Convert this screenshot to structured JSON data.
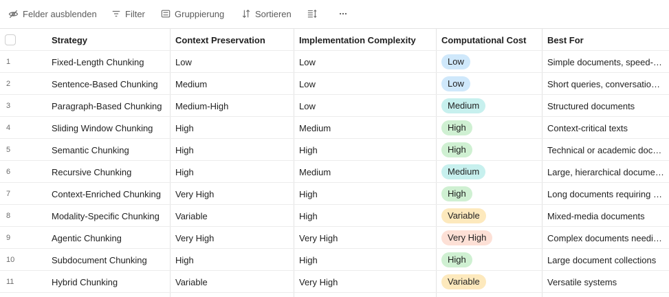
{
  "toolbar": {
    "hide_fields": "Felder ausblenden",
    "filter": "Filter",
    "group": "Gruppierung",
    "sort": "Sortieren",
    "icons": [
      "eye-slash-icon",
      "filter-icon",
      "group-icon",
      "sort-icon",
      "row-height-icon",
      "more-icon"
    ]
  },
  "table": {
    "columns": [
      "Strategy",
      "Context Preservation",
      "Implementation Complexity",
      "Computational Cost",
      "Best For"
    ],
    "rows": [
      {
        "num": "1",
        "strategy": "Fixed-Length Chunking",
        "context": "Low",
        "impl": "Low",
        "cost": "Low",
        "best": "Simple documents, speed-critical apps"
      },
      {
        "num": "2",
        "strategy": "Sentence-Based Chunking",
        "context": "Medium",
        "impl": "Low",
        "cost": "Low",
        "best": "Short queries, conversational data"
      },
      {
        "num": "3",
        "strategy": "Paragraph-Based Chunking",
        "context": "Medium-High",
        "impl": "Low",
        "cost": "Medium",
        "best": "Structured documents"
      },
      {
        "num": "4",
        "strategy": "Sliding Window Chunking",
        "context": "High",
        "impl": "Medium",
        "cost": "High",
        "best": "Context-critical texts"
      },
      {
        "num": "5",
        "strategy": "Semantic Chunking",
        "context": "High",
        "impl": "High",
        "cost": "High",
        "best": "Technical or academic documents"
      },
      {
        "num": "6",
        "strategy": "Recursive Chunking",
        "context": "High",
        "impl": "Medium",
        "cost": "Medium",
        "best": "Large, hierarchical documents"
      },
      {
        "num": "7",
        "strategy": "Context-Enriched Chunking",
        "context": "Very High",
        "impl": "High",
        "cost": "High",
        "best": "Long documents requiring context"
      },
      {
        "num": "8",
        "strategy": "Modality-Specific Chunking",
        "context": "Variable",
        "impl": "High",
        "cost": "Variable",
        "best": "Mixed-media documents"
      },
      {
        "num": "9",
        "strategy": "Agentic Chunking",
        "context": "Very High",
        "impl": "Very High",
        "cost": "Very High",
        "best": "Complex documents needing reasoning"
      },
      {
        "num": "10",
        "strategy": "Subdocument Chunking",
        "context": "High",
        "impl": "High",
        "cost": "High",
        "best": "Large document collections"
      },
      {
        "num": "11",
        "strategy": "Hybrid Chunking",
        "context": "Variable",
        "impl": "Very High",
        "cost": "Variable",
        "best": "Versatile systems"
      }
    ]
  },
  "colors": {
    "Low": "#cfe8fb",
    "Medium": "#c7f0ee",
    "High": "#cff0d2",
    "Variable": "#fde9bd",
    "Very High": "#fde0d6"
  }
}
